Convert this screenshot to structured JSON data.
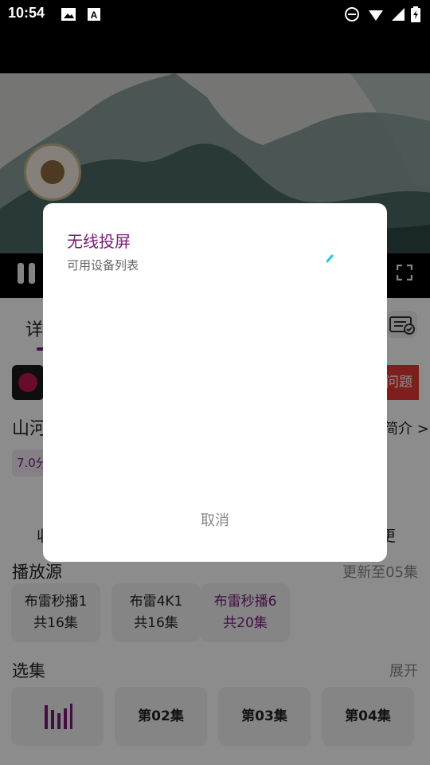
{
  "status_bar": {
    "time": "10:54",
    "icons": [
      "image-icon",
      "text-a-icon",
      "do-not-disturb-icon",
      "wifi-icon",
      "battery-icon"
    ]
  },
  "video": {
    "controls": [
      "pause-icon",
      "fullscreen-icon"
    ]
  },
  "page": {
    "tab_detail": "详",
    "feedback": "问题",
    "show_title": "山河",
    "intro_link": "简介 >",
    "rating": "7.0分",
    "collect": "收",
    "other": "更",
    "source_section": {
      "title": "播放源",
      "right": "更新至05集",
      "sources": [
        {
          "name": "布雷秒播1",
          "count": "共16集"
        },
        {
          "name": "布雷4K1",
          "count": "共16集"
        },
        {
          "name": "布雷秒播6",
          "count": "共20集"
        }
      ]
    },
    "episode_section": {
      "title": "选集",
      "right": "展开",
      "episodes": [
        "第02集",
        "第03集",
        "第04集"
      ]
    }
  },
  "dialog": {
    "title": "无线投屏",
    "subtitle": "可用设备列表",
    "cancel": "取消"
  },
  "colors": {
    "accent": "#7b1a7a",
    "status_bar": "#000000",
    "spinner": "#26c6da"
  }
}
